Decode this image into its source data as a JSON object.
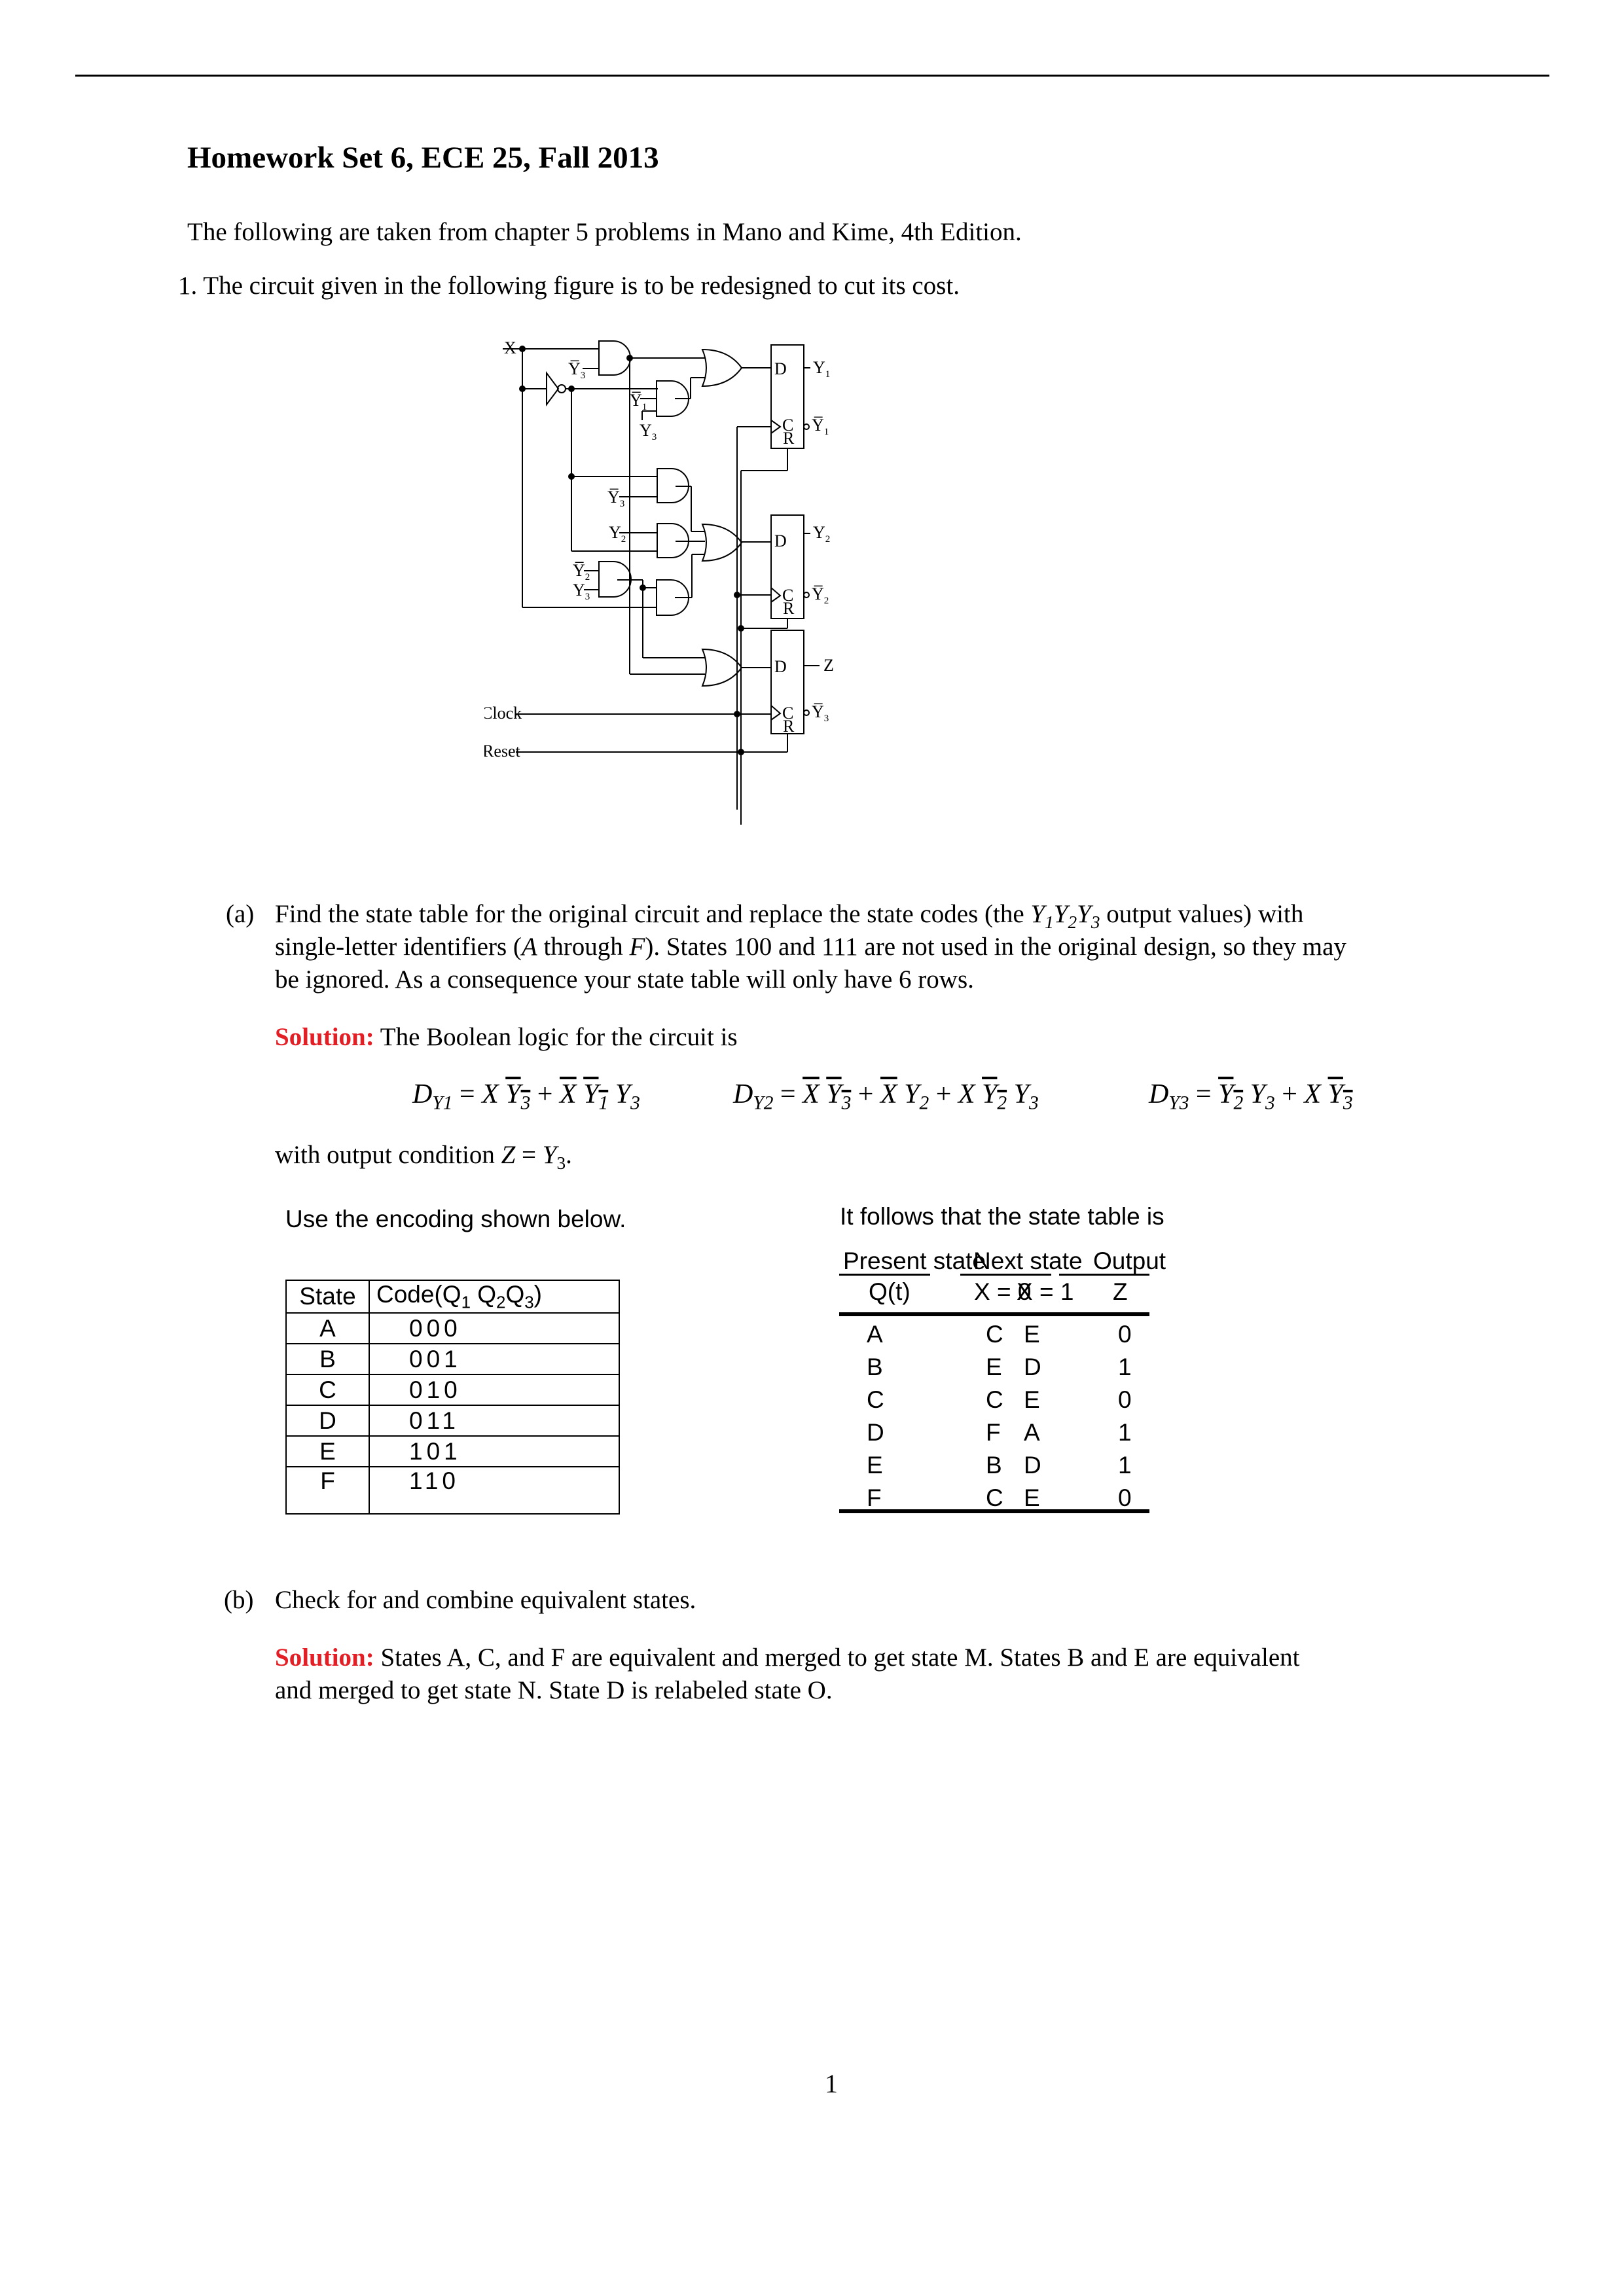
{
  "header": {
    "title": "Homework Set 6, ECE 25, Fall 2013",
    "intro": "The following are taken from chapter 5 problems in Mano and Kime, 4th Edition."
  },
  "problem1": {
    "number": "1.",
    "statement": "The circuit given in the following figure is to be redesigned to cut its cost.",
    "circuit": {
      "inputs": [
        "X",
        "Clock",
        "Reset"
      ],
      "gate_labels": {
        "y3_bar": "Y3",
        "y1_bar": "Y1",
        "y3": "Y3",
        "y2": "Y2",
        "y2_bar": "Y2"
      },
      "flipflops": [
        {
          "d": "D",
          "c": "C",
          "r": "R",
          "q": "Y1",
          "q_bar": "Y1"
        },
        {
          "d": "D",
          "c": "C",
          "r": "R",
          "q": "Y2",
          "q_bar": "Y2"
        },
        {
          "d": "D",
          "c": "C",
          "r": "R",
          "q": "Z",
          "q_bar": "Y3"
        }
      ]
    },
    "part_a": {
      "label": "(a)",
      "line1": "Find the state table for the original circuit and replace the state codes (the ",
      "line1_math": "Y",
      "line1_end": " output values) with",
      "line2_start": "single-letter identifiers (",
      "line2_a": "A",
      "line2_mid": " through ",
      "line2_f": "F",
      "line2_end": "). States 100 and 111 are not used in the original design, so they may",
      "line3": "be ignored. As a consequence your state table will only have 6 rows.",
      "solution_label": "Solution:",
      "solution_text": "The Boolean logic for the circuit is",
      "output_condition_prefix": "with output condition ",
      "output_condition": "Z = Y",
      "encoding_intro": "Use the encoding shown below.",
      "encoding_table": {
        "headers": [
          "State",
          "Code(Q"
        ],
        "rows": [
          {
            "state": "A",
            "code": "000"
          },
          {
            "state": "B",
            "code": "001"
          },
          {
            "state": "C",
            "code": "010"
          },
          {
            "state": "D",
            "code": "011"
          },
          {
            "state": "E",
            "code": "101"
          },
          {
            "state": "F",
            "code": "110"
          }
        ]
      },
      "state_table_intro": "It follows that the state table is",
      "state_table": {
        "group_headers": [
          "Present state",
          "Next state",
          "Output"
        ],
        "sub_headers": [
          "Q(t)",
          "X = 0",
          "X = 1",
          "Z"
        ],
        "rows": [
          {
            "present": "A",
            "x0": "C",
            "x1": "E",
            "z": "0"
          },
          {
            "present": "B",
            "x0": "E",
            "x1": "D",
            "z": "1"
          },
          {
            "present": "C",
            "x0": "C",
            "x1": "E",
            "z": "0"
          },
          {
            "present": "D",
            "x0": "F",
            "x1": "A",
            "z": "1"
          },
          {
            "present": "E",
            "x0": "B",
            "x1": "D",
            "z": "1"
          },
          {
            "present": "F",
            "x0": "C",
            "x1": "E",
            "z": "0"
          }
        ]
      }
    },
    "part_b": {
      "label": "(b)",
      "text": "Check for and combine equivalent states.",
      "solution_label": "Solution:",
      "solution_line1": "States A, C, and F are equivalent and merged to get state M. States B and E are equivalent",
      "solution_line2": "and merged to get state N. State D is relabeled state O."
    }
  },
  "footer": {
    "page_number": "1"
  },
  "colors": {
    "solution": "#e31e24"
  }
}
